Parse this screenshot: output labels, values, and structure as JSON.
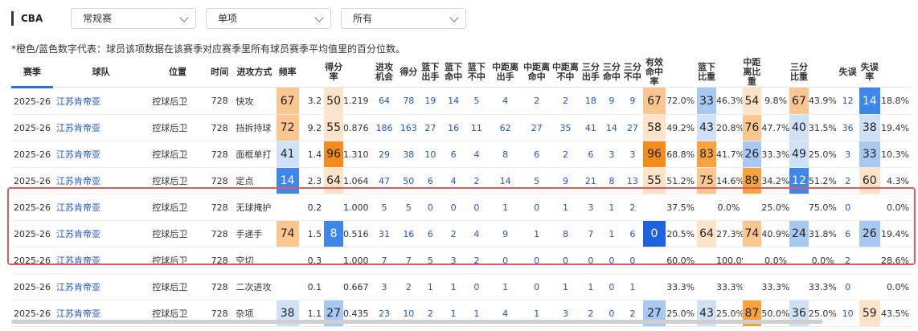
{
  "header": {
    "league": "CBA",
    "dropdown_season_type": "常规赛",
    "dropdown_category": "单项",
    "dropdown_scope": "所有"
  },
  "note": "*橙色/蓝色数字代表：球员该项数据在该赛季对应赛季里所有球员赛季平均值里的百分位数。",
  "columns": [
    {
      "label": "赛季"
    },
    {
      "label": "球队"
    },
    {
      "label": "位置"
    },
    {
      "label": "时间"
    },
    {
      "label": "进攻方式"
    },
    {
      "label": "频率"
    },
    {
      "label": ""
    },
    {
      "label": "得分率"
    },
    {
      "label": ""
    },
    {
      "label": "进攻\n机会"
    },
    {
      "label": "得分"
    },
    {
      "label": "篮下\n出手"
    },
    {
      "label": "篮下\n命中"
    },
    {
      "label": "篮下\n不中"
    },
    {
      "label": "中距离\n出手"
    },
    {
      "label": "中距离\n命中"
    },
    {
      "label": "中距离\n不中"
    },
    {
      "label": "三分\n出手"
    },
    {
      "label": "三分\n命中"
    },
    {
      "label": "三分\n不中"
    },
    {
      "label": "有效\n命中率"
    },
    {
      "label": ""
    },
    {
      "label": "篮下比重"
    },
    {
      "label": ""
    },
    {
      "label": "中距离比重"
    },
    {
      "label": ""
    },
    {
      "label": "三分比重"
    },
    {
      "label": ""
    },
    {
      "label": "失误"
    },
    {
      "label": "失误率"
    },
    {
      "label": ""
    }
  ],
  "colors": {
    "orange_light": "#fde3c8",
    "orange_mid": "#fcc690",
    "orange_strong": "#f9a23e",
    "orange_max": "#f28d1d",
    "blue_light": "#cfe1f7",
    "blue_mid": "#a7c8f1",
    "blue_strong": "#3d86ea",
    "blue_max": "#1f62e0",
    "link": "#1f57c8",
    "highlight": "#e4595d",
    "sort": "#2c6fdc"
  },
  "rows": [
    {
      "season": "2025-26",
      "team": "江苏肯帝亚",
      "pos": "控球后卫",
      "time": "728",
      "type": "快攻",
      "freq_pct": "67",
      "freq": "3.2",
      "ppp_pct": "50",
      "ppp": "1.219",
      "poss": "64",
      "pts": "78",
      "rim_att": "19",
      "rim_make": "14",
      "rim_miss": "5",
      "mid_att": "4",
      "mid_make": "2",
      "mid_miss": "2",
      "three_att": "18",
      "three_make": "9",
      "three_miss": "9",
      "efg_pct": "67",
      "efg": "72.0%",
      "rim_share_pct": "33",
      "rim_share": "46.3%",
      "mid_share_pct": "54",
      "mid_share": "9.8%",
      "three_share_pct": "67",
      "three_share": "43.9%",
      "tov": "12",
      "tov_rate_pct": "14",
      "tov_rate": "18.8%"
    },
    {
      "season": "2025-26",
      "team": "江苏肯帝亚",
      "pos": "控球后卫",
      "time": "728",
      "type": "挡拆持球",
      "freq_pct": "72",
      "freq": "9.2",
      "ppp_pct": "55",
      "ppp": "0.876",
      "poss": "186",
      "pts": "163",
      "rim_att": "27",
      "rim_make": "16",
      "rim_miss": "11",
      "mid_att": "62",
      "mid_make": "27",
      "mid_miss": "35",
      "three_att": "41",
      "three_make": "14",
      "three_miss": "27",
      "efg_pct": "58",
      "efg": "49.2%",
      "rim_share_pct": "43",
      "rim_share": "20.8%",
      "mid_share_pct": "76",
      "mid_share": "47.7%",
      "three_share_pct": "40",
      "three_share": "31.5%",
      "tov": "36",
      "tov_rate_pct": "38",
      "tov_rate": "19.4%"
    },
    {
      "season": "2025-26",
      "team": "江苏肯帝亚",
      "pos": "控球后卫",
      "time": "728",
      "type": "面框单打",
      "freq_pct": "41",
      "freq": "1.4",
      "ppp_pct": "96",
      "ppp": "1.310",
      "poss": "29",
      "pts": "38",
      "rim_att": "10",
      "rim_make": "6",
      "rim_miss": "4",
      "mid_att": "8",
      "mid_make": "6",
      "mid_miss": "2",
      "three_att": "6",
      "three_make": "3",
      "three_miss": "3",
      "efg_pct": "96",
      "efg": "68.8%",
      "rim_share_pct": "83",
      "rim_share": "41.7%",
      "mid_share_pct": "26",
      "mid_share": "33.3%",
      "three_share_pct": "49",
      "three_share": "25.0%",
      "tov": "3",
      "tov_rate_pct": "33",
      "tov_rate": "10.3%"
    },
    {
      "season": "2025-26",
      "team": "江苏肯帝亚",
      "pos": "控球后卫",
      "time": "728",
      "type": "定点",
      "freq_pct": "14",
      "freq": "2.3",
      "ppp_pct": "64",
      "ppp": "1.064",
      "poss": "47",
      "pts": "50",
      "rim_att": "6",
      "rim_make": "4",
      "rim_miss": "2",
      "mid_att": "14",
      "mid_make": "5",
      "mid_miss": "9",
      "three_att": "21",
      "three_make": "8",
      "three_miss": "13",
      "efg_pct": "55",
      "efg": "51.2%",
      "rim_share_pct": "75",
      "rim_share": "14.6%",
      "mid_share_pct": "89",
      "mid_share": "34.2%",
      "three_share_pct": "12",
      "three_share": "51.2%",
      "tov": "2",
      "tov_rate_pct": "60",
      "tov_rate": "4.3%"
    },
    {
      "season": "2025-26",
      "team": "江苏肯帝亚",
      "pos": "控球后卫",
      "time": "728",
      "type": "无球掩护",
      "freq_pct": "",
      "freq": "0.2",
      "ppp_pct": "",
      "ppp": "1.000",
      "poss": "5",
      "pts": "5",
      "rim_att": "0",
      "rim_make": "0",
      "rim_miss": "0",
      "mid_att": "1",
      "mid_make": "0",
      "mid_miss": "1",
      "three_att": "3",
      "three_make": "1",
      "three_miss": "2",
      "efg_pct": "",
      "efg": "37.5%",
      "rim_share_pct": "",
      "rim_share": "0.0%",
      "mid_share_pct": "",
      "mid_share": "25.0%",
      "three_share_pct": "",
      "three_share": "75.0%",
      "tov": "0",
      "tov_rate_pct": "",
      "tov_rate": "0.0%"
    },
    {
      "season": "2025-26",
      "team": "江苏肯帝亚",
      "pos": "控球后卫",
      "time": "728",
      "type": "手递手",
      "freq_pct": "74",
      "freq": "1.5",
      "ppp_pct": "8",
      "ppp": "0.516",
      "poss": "31",
      "pts": "16",
      "rim_att": "6",
      "rim_make": "2",
      "rim_miss": "4",
      "mid_att": "9",
      "mid_make": "1",
      "mid_miss": "8",
      "three_att": "7",
      "three_make": "1",
      "three_miss": "6",
      "efg_pct": "0",
      "efg": "20.5%",
      "rim_share_pct": "64",
      "rim_share": "27.3%",
      "mid_share_pct": "74",
      "mid_share": "40.9%",
      "three_share_pct": "24",
      "three_share": "31.8%",
      "tov": "6",
      "tov_rate_pct": "26",
      "tov_rate": "19.4%"
    },
    {
      "season": "2025-26",
      "team": "江苏肯帝亚",
      "pos": "控球后卫",
      "time": "728",
      "type": "空切",
      "freq_pct": "",
      "freq": "0.3",
      "ppp_pct": "",
      "ppp": "1.000",
      "poss": "7",
      "pts": "7",
      "rim_att": "5",
      "rim_make": "3",
      "rim_miss": "2",
      "mid_att": "0",
      "mid_make": "0",
      "mid_miss": "0",
      "three_att": "0",
      "three_make": "0",
      "three_miss": "0",
      "efg_pct": "",
      "efg": "60.0%",
      "rim_share_pct": "",
      "rim_share": "100.0%",
      "mid_share_pct": "",
      "mid_share": "0.0%",
      "three_share_pct": "",
      "three_share": "0.0%",
      "tov": "2",
      "tov_rate_pct": "",
      "tov_rate": "28.6%"
    },
    {
      "season": "2025-26",
      "team": "江苏肯帝亚",
      "pos": "控球后卫",
      "time": "728",
      "type": "二次进攻",
      "freq_pct": "",
      "freq": "0.1",
      "ppp_pct": "",
      "ppp": "0.667",
      "poss": "3",
      "pts": "2",
      "rim_att": "1",
      "rim_make": "1",
      "rim_miss": "0",
      "mid_att": "1",
      "mid_make": "0",
      "mid_miss": "1",
      "three_att": "1",
      "three_make": "0",
      "three_miss": "1",
      "efg_pct": "",
      "efg": "33.3%",
      "rim_share_pct": "",
      "rim_share": "33.3%",
      "mid_share_pct": "",
      "mid_share": "33.3%",
      "three_share_pct": "",
      "three_share": "33.3%",
      "tov": "0",
      "tov_rate_pct": "",
      "tov_rate": "0.0%"
    },
    {
      "season": "2025-26",
      "team": "江苏肯帝亚",
      "pos": "控球后卫",
      "time": "728",
      "type": "杂项",
      "freq_pct": "38",
      "freq": "1.1",
      "ppp_pct": "27",
      "ppp": "0.435",
      "poss": "23",
      "pts": "10",
      "rim_att": "2",
      "rim_make": "1",
      "rim_miss": "1",
      "mid_att": "4",
      "mid_make": "1",
      "mid_miss": "3",
      "three_att": "2",
      "three_make": "0",
      "three_miss": "2",
      "efg_pct": "27",
      "efg": "25.0%",
      "rim_share_pct": "43",
      "rim_share": "25.0%",
      "mid_share_pct": "87",
      "mid_share": "50.0%",
      "three_share_pct": "36",
      "three_share": "25.0%",
      "tov": "10",
      "tov_rate_pct": "59",
      "tov_rate": "43.5%"
    }
  ]
}
